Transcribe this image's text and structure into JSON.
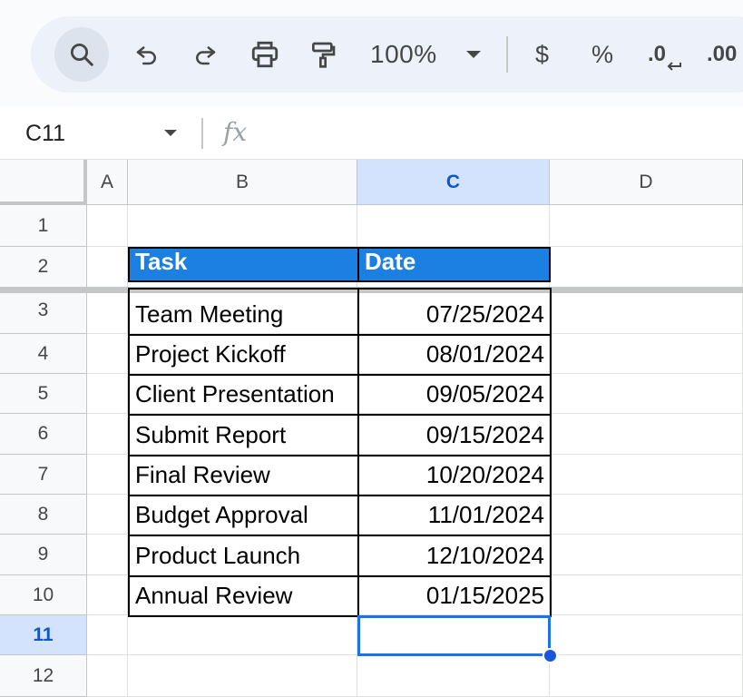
{
  "toolbar": {
    "zoom": "100%",
    "currency_symbol": "$",
    "percent_symbol": "%",
    "decrease_decimal_label": ".0",
    "increase_decimal_label": ".00"
  },
  "formula_bar": {
    "name_box": "C11",
    "fx_label": "fx",
    "formula": ""
  },
  "grid": {
    "columns": [
      "A",
      "B",
      "C",
      "D"
    ],
    "selected_column": "C",
    "rows": [
      "1",
      "2",
      "3",
      "4",
      "5",
      "6",
      "7",
      "8",
      "9",
      "10",
      "11",
      "12"
    ],
    "selected_row": "11",
    "table": {
      "headers": {
        "task": "Task",
        "date": "Date"
      },
      "rows": [
        {
          "task": "Team Meeting",
          "date": "07/25/2024"
        },
        {
          "task": "Project Kickoff",
          "date": "08/01/2024"
        },
        {
          "task": "Client Presentation",
          "date": "09/05/2024"
        },
        {
          "task": "Submit Report",
          "date": "09/15/2024"
        },
        {
          "task": "Final Review",
          "date": "10/20/2024"
        },
        {
          "task": "Budget Approval",
          "date": "11/01/2024"
        },
        {
          "task": "Product Launch",
          "date": "12/10/2024"
        },
        {
          "task": "Annual Review",
          "date": "01/15/2025"
        }
      ]
    }
  },
  "colors": {
    "header_fill": "#1c80e3",
    "selection": "#1a73e8",
    "selected_header": "#d3e3fd"
  },
  "icons": [
    "search-icon",
    "undo-icon",
    "redo-icon",
    "print-icon",
    "paint-format-icon",
    "chevron-down-icon",
    "function-icon"
  ]
}
